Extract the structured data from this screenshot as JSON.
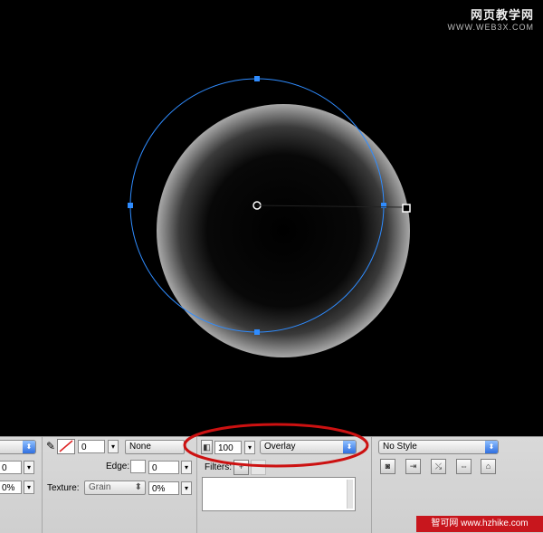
{
  "watermark_top": {
    "line1": "网页教学网",
    "line2": "WWW.WEB3X.COM"
  },
  "properties": {
    "stroke_size": "0",
    "stroke_category": "None",
    "edge_label": "Edge:",
    "edge_value": "0",
    "texture_label": "Texture:",
    "texture_value": "Grain",
    "texture_amount": "0%",
    "left_field_1": "0",
    "left_field_2": "0%",
    "opacity": "100",
    "blend_mode": "Overlay",
    "filters_label": "Filters:",
    "style": "No Style"
  },
  "colors": {
    "selection": "#2f8cff",
    "highlight_ellipse": "#cc1111",
    "panel": "#d4d4d4"
  },
  "watermark_bottom": "智可网  www.hzhike.com"
}
